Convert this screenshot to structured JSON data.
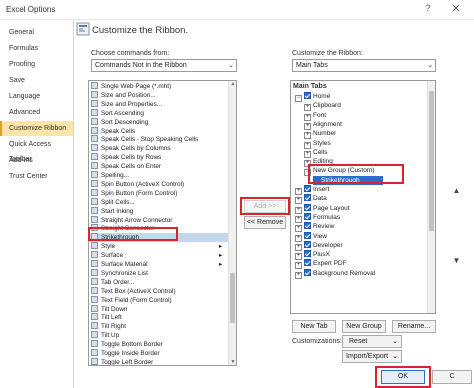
{
  "window": {
    "title": "Excel Options",
    "help_glyph": "?",
    "close_glyph": "✕"
  },
  "nav": {
    "items": [
      {
        "label": "General",
        "active": false
      },
      {
        "label": "Formulas",
        "active": false
      },
      {
        "label": "Proofing",
        "active": false
      },
      {
        "label": "Save",
        "active": false
      },
      {
        "label": "Language",
        "active": false
      },
      {
        "label": "Advanced",
        "active": false
      },
      {
        "label": "Customize Ribbon",
        "active": true
      },
      {
        "label": "Quick Access Toolbar",
        "active": false
      },
      {
        "label": "Add-ins",
        "active": false
      },
      {
        "label": "Trust Center",
        "active": false
      }
    ]
  },
  "main": {
    "heading": "Customize the Ribbon.",
    "choose_label": "Choose commands from:",
    "choose_value": "Commands Not in the Ribbon",
    "customize_label": "Customize the Ribbon:",
    "customize_value": "Main Tabs"
  },
  "commands": [
    {
      "label": "Single Web Page (*.mht)",
      "icon": "page-icon"
    },
    {
      "label": "Size and Position...",
      "icon": "size-icon"
    },
    {
      "label": "Size and Properties...",
      "icon": "size-icon"
    },
    {
      "label": "Sort Ascending",
      "icon": "sort-icon"
    },
    {
      "label": "Sort Descending",
      "icon": "sort-icon"
    },
    {
      "label": "Speak Cells",
      "icon": "speak-icon"
    },
    {
      "label": "Speak Cells - Stop Speaking Cells",
      "icon": "speak-icon"
    },
    {
      "label": "Speak Cells by Columns",
      "icon": "speak-icon"
    },
    {
      "label": "Speak Cells by Rows",
      "icon": "speak-icon"
    },
    {
      "label": "Speak Cells on Enter",
      "icon": "speak-icon"
    },
    {
      "label": "Spelling...",
      "icon": "spelling-icon"
    },
    {
      "label": "Spin Button (ActiveX Control)",
      "icon": "spin-icon"
    },
    {
      "label": "Spin Button (Form Control)",
      "icon": "spin-icon"
    },
    {
      "label": "Split Cells...",
      "icon": "split-icon"
    },
    {
      "label": "Start Inking",
      "icon": "ink-icon"
    },
    {
      "label": "Straight Arrow Connector",
      "icon": "arrow-icon"
    },
    {
      "label": "Straight Connector",
      "icon": "line-icon"
    },
    {
      "label": "Strikethrough",
      "icon": "strike-icon"
    },
    {
      "label": "Style",
      "icon": "style-icon",
      "arrow": true
    },
    {
      "label": "Surface",
      "icon": "surface-icon",
      "arrow": true
    },
    {
      "label": "Surface Material",
      "icon": "surface-icon",
      "arrow": true
    },
    {
      "label": "Synchronize List",
      "icon": "sync-icon"
    },
    {
      "label": "Tab Order...",
      "icon": "tab-icon"
    },
    {
      "label": "Text Box (ActiveX Control)",
      "icon": "textbox-icon"
    },
    {
      "label": "Text Field (Form Control)",
      "icon": "textbox-icon"
    },
    {
      "label": "Tilt Down",
      "icon": "tilt-icon"
    },
    {
      "label": "Tilt Left",
      "icon": "tilt-icon"
    },
    {
      "label": "Tilt Right",
      "icon": "tilt-icon"
    },
    {
      "label": "Tilt Up",
      "icon": "tilt-icon"
    },
    {
      "label": "Toggle Bottom Border",
      "icon": "border-icon"
    },
    {
      "label": "Toggle Inside Border",
      "icon": "border-icon"
    },
    {
      "label": "Toggle Left Border",
      "icon": "border-icon"
    }
  ],
  "selected_command": "Strikethrough",
  "buttons": {
    "add": "Add >>",
    "remove": "<< Remove",
    "new_tab": "New Tab",
    "new_group": "New Group",
    "rename": "Rename...",
    "customizations_label": "Customizations:",
    "reset": "Reset",
    "import_export": "Import/Export",
    "ok": "OK",
    "cancel": "C"
  },
  "tree": {
    "header": "Main Tabs",
    "rows": [
      {
        "label": "Home",
        "level": 0,
        "expander": "⊟",
        "checkbox": true
      },
      {
        "label": "Clipboard",
        "level": 1,
        "expander": "⊞",
        "checkbox": false
      },
      {
        "label": "Font",
        "level": 1,
        "expander": "⊞",
        "checkbox": false
      },
      {
        "label": "Alignment",
        "level": 1,
        "expander": "⊞",
        "checkbox": false
      },
      {
        "label": "Number",
        "level": 1,
        "expander": "⊞",
        "checkbox": false
      },
      {
        "label": "Styles",
        "level": 1,
        "expander": "⊞",
        "checkbox": false
      },
      {
        "label": "Cells",
        "level": 1,
        "expander": "⊞",
        "checkbox": false
      },
      {
        "label": "Editing",
        "level": 1,
        "expander": "⊞",
        "checkbox": false
      },
      {
        "label": "New Group (Custom)",
        "level": 1,
        "expander": "⊟",
        "checkbox": false
      },
      {
        "label": "Strikethrough",
        "level": 2,
        "expander": "",
        "checkbox": false,
        "selected": true
      },
      {
        "label": "Insert",
        "level": 0,
        "expander": "⊞",
        "checkbox": true
      },
      {
        "label": "Data",
        "level": 0,
        "expander": "⊞",
        "checkbox": true
      },
      {
        "label": "Page Layout",
        "level": 0,
        "expander": "⊞",
        "checkbox": true
      },
      {
        "label": "Formulas",
        "level": 0,
        "expander": "⊞",
        "checkbox": true
      },
      {
        "label": "Review",
        "level": 0,
        "expander": "⊞",
        "checkbox": true
      },
      {
        "label": "View",
        "level": 0,
        "expander": "⊞",
        "checkbox": true
      },
      {
        "label": "Developer",
        "level": 0,
        "expander": "⊞",
        "checkbox": true
      },
      {
        "label": "PlusX",
        "level": 0,
        "expander": "⊞",
        "checkbox": true
      },
      {
        "label": "Expert PDF",
        "level": 0,
        "expander": "⊞",
        "checkbox": true
      },
      {
        "label": "Background Removal",
        "level": 0,
        "expander": "⊞",
        "checkbox": true
      }
    ]
  },
  "colors": {
    "accent": "#2a6ecb",
    "highlight_red": "#d9232e",
    "nav_active": "#fbe5a8"
  }
}
